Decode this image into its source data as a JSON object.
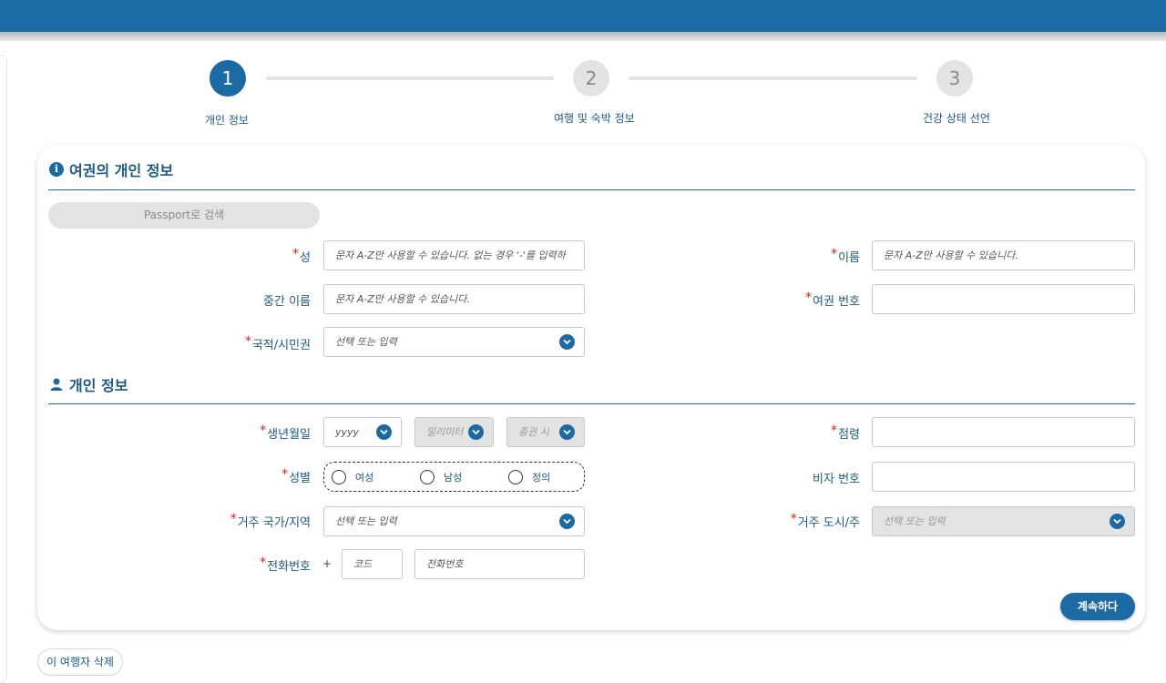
{
  "stepper": {
    "steps": [
      {
        "number": "1",
        "label": "개인 정보"
      },
      {
        "number": "2",
        "label": "여행 및 숙박 정보"
      },
      {
        "number": "3",
        "label": "건강 상태 선언"
      }
    ]
  },
  "passport_section": {
    "title": "여권의 개인 정보",
    "search_button": "Passport로 검색",
    "surname_label": "성",
    "surname_placeholder": "문자 A-Z만 사용할 수 있습니다. 없는 경우 '-'를 입력하",
    "given_name_label": "이름",
    "given_name_placeholder": "문자 A-Z만 사용할 수 있습니다.",
    "middle_name_label": "중간 이름",
    "middle_name_placeholder": "문자 A-Z만 사용할 수 있습니다.",
    "passport_number_label": "여권 번호",
    "passport_number_value": "",
    "nationality_label": "국적/시민권",
    "nationality_placeholder": "선택 또는 입력"
  },
  "personal_section": {
    "title": "개인 정보",
    "dob_label": "생년월일",
    "dob_year_placeholder": "yyyy",
    "dob_month_placeholder": "밀리미터",
    "dob_day_placeholder": "종권 시",
    "age_label": "점령",
    "age_value": "",
    "gender_label": "성별",
    "gender_options": [
      "여성",
      "남성",
      "정의"
    ],
    "visa_label": "비자 번호",
    "visa_value": "",
    "country_label": "거주 국가/지역",
    "country_placeholder": "선택 또는 입력",
    "city_label": "거주 도시/주",
    "city_placeholder": "선택 또는 입력",
    "phone_label": "전화번호",
    "phone_prefix": "+",
    "phone_code_placeholder": "코드",
    "phone_number_placeholder": "전화번호"
  },
  "actions": {
    "continue_label": "계속하다",
    "delete_label": "이 여행자 삭제"
  },
  "colors": {
    "primary": "#1c6aa3",
    "required": "#e02020",
    "disabled": "#e3e3e3"
  }
}
